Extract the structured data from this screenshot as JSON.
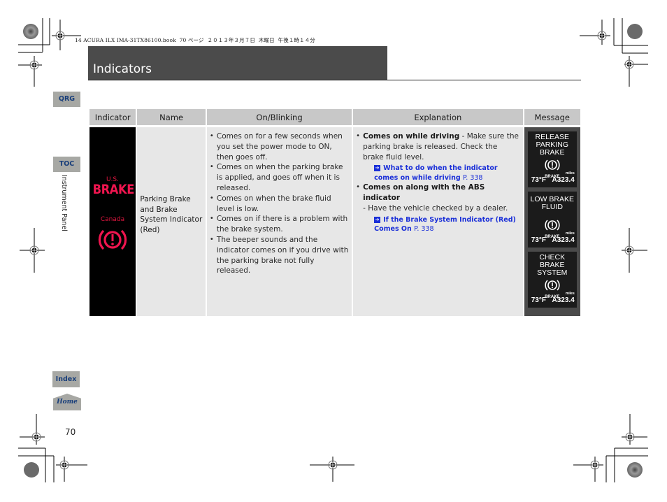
{
  "print_header": "14 ACURA ILX IMA-31TX86100.book  70 ページ  ２０１３年３月７日  木曜日  午後１時１４分",
  "page": {
    "title": "Indicators",
    "section_label": "Instrument Panel",
    "page_number": "70"
  },
  "nav": {
    "qrg": "QRG",
    "toc": "TOC",
    "index": "Index",
    "home": "Home"
  },
  "colors": {
    "title_bar": "#4b4b4b",
    "nav_button": "#a7a8a4",
    "nav_text": "#183e7a",
    "indicator_red": "#f0154f",
    "link_blue": "#1a2fd8",
    "header_cell": "#c8c8c8",
    "body_cell": "#e7e7e7"
  },
  "table": {
    "headers": [
      "Indicator",
      "Name",
      "On/Blinking",
      "Explanation",
      "Message"
    ],
    "row": {
      "indicator": {
        "us_label": "U.S.",
        "us_symbol": "BRAKE",
        "canada_label": "Canada",
        "canada_icon": "brake-warning-icon"
      },
      "name": "Parking Brake and Brake System Indicator (Red)",
      "on_blinking": [
        "Comes on for a few seconds when you set the power mode to ON, then goes off.",
        "Comes on when the parking brake is applied, and goes off when it is released.",
        "Comes on when the brake fluid level is low.",
        "Comes on if there is a problem with the brake system.",
        "The beeper sounds and the indicator comes on if you drive with the parking brake not fully released."
      ],
      "explanation": [
        {
          "bold": "Comes on while driving",
          "text": " - Make sure the parking brake is released. Check the brake fluid level.",
          "link": "What to do when the indicator comes on while driving",
          "link_page": "P. 338"
        },
        {
          "bold": "Comes on along with the ABS indicator",
          "text": "- Have the vehicle checked by a dealer.",
          "link": "If the Brake System Indicator (Red) Comes On",
          "link_page": "P. 338"
        }
      ],
      "messages": [
        {
          "lines": "RELEASE\nPARKING\nBRAKE",
          "icon_label": "BRAKE",
          "temp": "73°F",
          "odo": "A323.4",
          "unit": "miles"
        },
        {
          "lines": "LOW BRAKE\nFLUID",
          "icon_label": "BRAKE",
          "temp": "73°F",
          "odo": "A323.4",
          "unit": "miles"
        },
        {
          "lines": "CHECK\nBRAKE\nSYSTEM",
          "icon_label": "BRAKE",
          "temp": "73°F",
          "odo": "A323.4",
          "unit": "miles"
        }
      ]
    }
  }
}
